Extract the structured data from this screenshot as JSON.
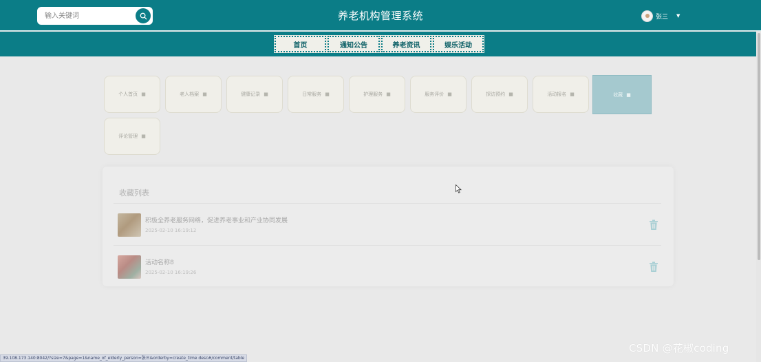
{
  "header": {
    "search_placeholder": "输入关键词",
    "title": "养老机构管理系统",
    "user_name": "张三",
    "caret": "▼"
  },
  "nav": {
    "items": [
      "首页",
      "通知公告",
      "养老资讯",
      "娱乐活动"
    ]
  },
  "menu": {
    "tiles": [
      "个人首页",
      "老人档案",
      "健康记录",
      "日常服务",
      "护理服务",
      "服务评价",
      "探访预约",
      "活动报名",
      "收藏",
      "评论管理"
    ],
    "active": "收藏"
  },
  "favorites": {
    "title": "收藏列表",
    "items": [
      {
        "name": "积极全养老服务网络，促进养老事业和产业协同发展",
        "time": "2025-02-10 16:19:12"
      },
      {
        "name": "活动名称8",
        "time": "2025-02-10 16:19:26"
      }
    ]
  },
  "status_bar": {
    "url": "39.108.173.140:8042/?size=7&page=1&name_of_elderly_person=张三&orderby=create_time desc#/comment/table"
  },
  "watermark": "CSDN @花椒coding",
  "colors": {
    "primary": "#0b7d87",
    "active_tile": "#a5c9cf",
    "background": "#e9e9e9"
  },
  "icons": {
    "search": "search-icon",
    "trash": "trash-icon",
    "lock": "lock-icon",
    "caret": "caret-down-icon"
  }
}
